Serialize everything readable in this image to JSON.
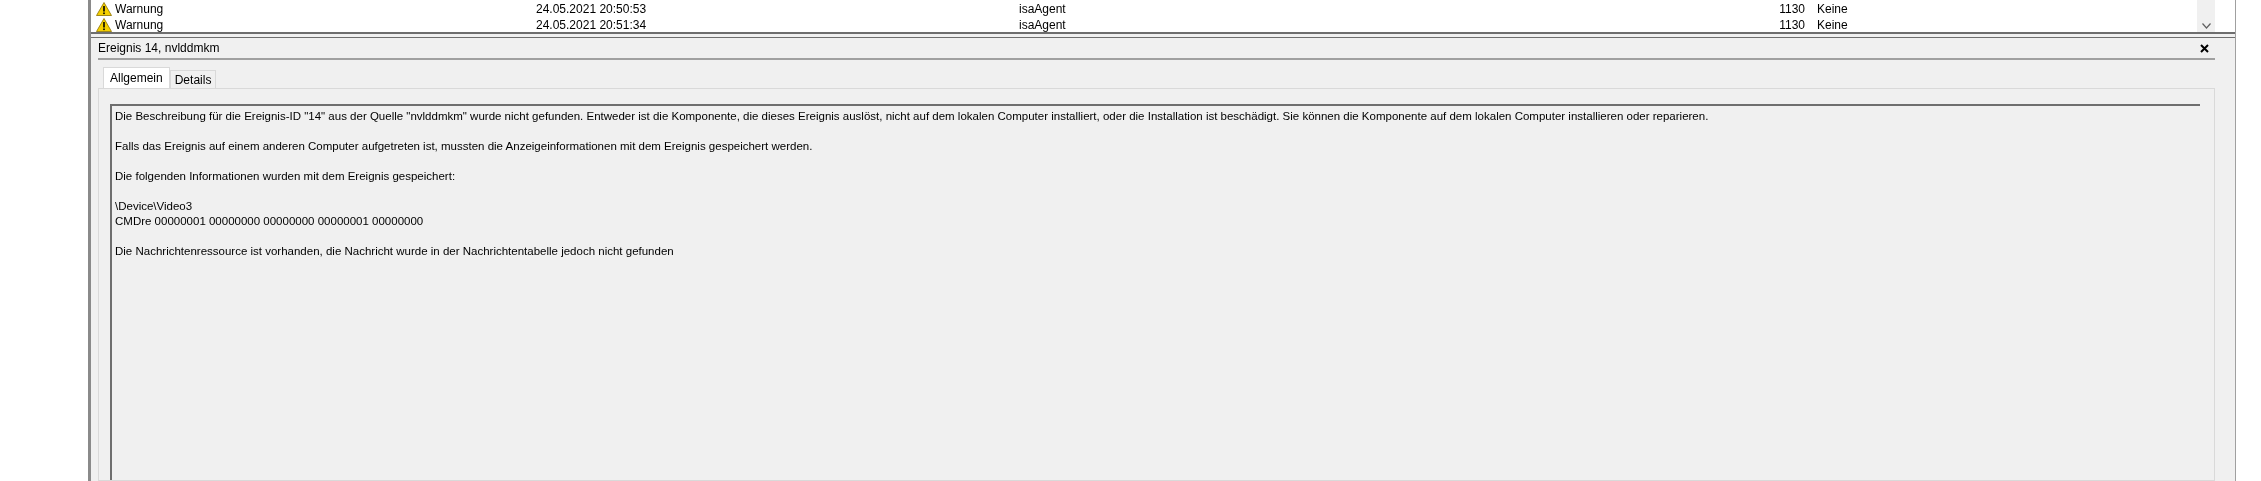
{
  "event_list": {
    "rows": [
      {
        "level": "Warnung",
        "date": "24.05.2021 20:50:53",
        "source": "isaAgent",
        "event_id": "1130",
        "category": "Keine"
      },
      {
        "level": "Warnung",
        "date": "24.05.2021 20:51:34",
        "source": "isaAgent",
        "event_id": "1130",
        "category": "Keine"
      }
    ]
  },
  "details_panel": {
    "title": "Ereignis 14, nvlddmkm",
    "tabs": [
      {
        "label": "Allgemein",
        "selected": true
      },
      {
        "label": "Details",
        "selected": false
      }
    ],
    "description": [
      "Die Beschreibung für die Ereignis-ID \"14\" aus der Quelle \"nvlddmkm\" wurde nicht gefunden. Entweder ist die Komponente, die dieses Ereignis auslöst, nicht auf dem lokalen Computer installiert, oder die Installation ist beschädigt. Sie können die Komponente auf dem lokalen Computer installieren oder reparieren.",
      "Falls das Ereignis auf einem anderen Computer aufgetreten ist, mussten die Anzeigeinformationen mit dem Ereignis gespeichert werden.",
      "Die folgenden Informationen wurden mit dem Ereignis gespeichert:",
      [
        "\\Device\\Video3",
        "CMDre 00000001 00000000 00000000 00000001 00000000"
      ],
      "Die Nachrichtenressource ist vorhanden, die Nachricht wurde in der Nachrichtentabelle jedoch nicht gefunden"
    ]
  }
}
